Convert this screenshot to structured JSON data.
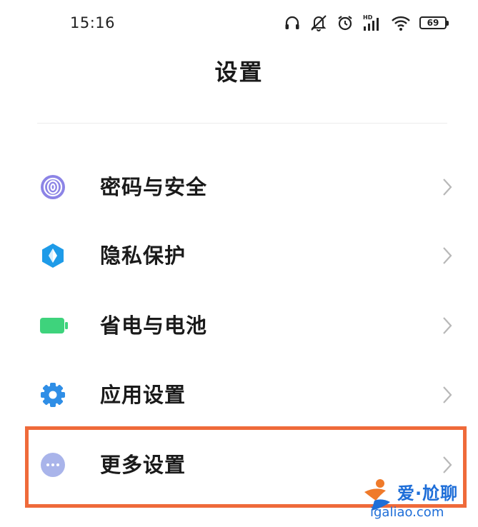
{
  "status_bar": {
    "time": "15:16",
    "battery_level": "69",
    "icons": [
      "headphones-icon",
      "mute-icon",
      "alarm-icon",
      "hd-signal-icon",
      "wifi-icon",
      "battery-icon"
    ]
  },
  "header": {
    "title": "设置"
  },
  "settings": {
    "items": [
      {
        "label": "密码与安全",
        "icon": "fingerprint-icon",
        "icon_color": "#8c84e6"
      },
      {
        "label": "隐私保护",
        "icon": "privacy-shield-icon",
        "icon_color": "#1e9be8"
      },
      {
        "label": "省电与电池",
        "icon": "battery-saver-icon",
        "icon_color": "#3ed37c"
      },
      {
        "label": "应用设置",
        "icon": "gear-icon",
        "icon_color": "#2f8ee6"
      },
      {
        "label": "更多设置",
        "icon": "more-dots-icon",
        "icon_color": "#a9b4ea"
      }
    ]
  },
  "highlight": {
    "color": "#ef6a3a",
    "target": "更多设置"
  },
  "watermark": {
    "title": "爱·尬聊",
    "url": "igaliao.com",
    "color": "#1e6ed8"
  }
}
